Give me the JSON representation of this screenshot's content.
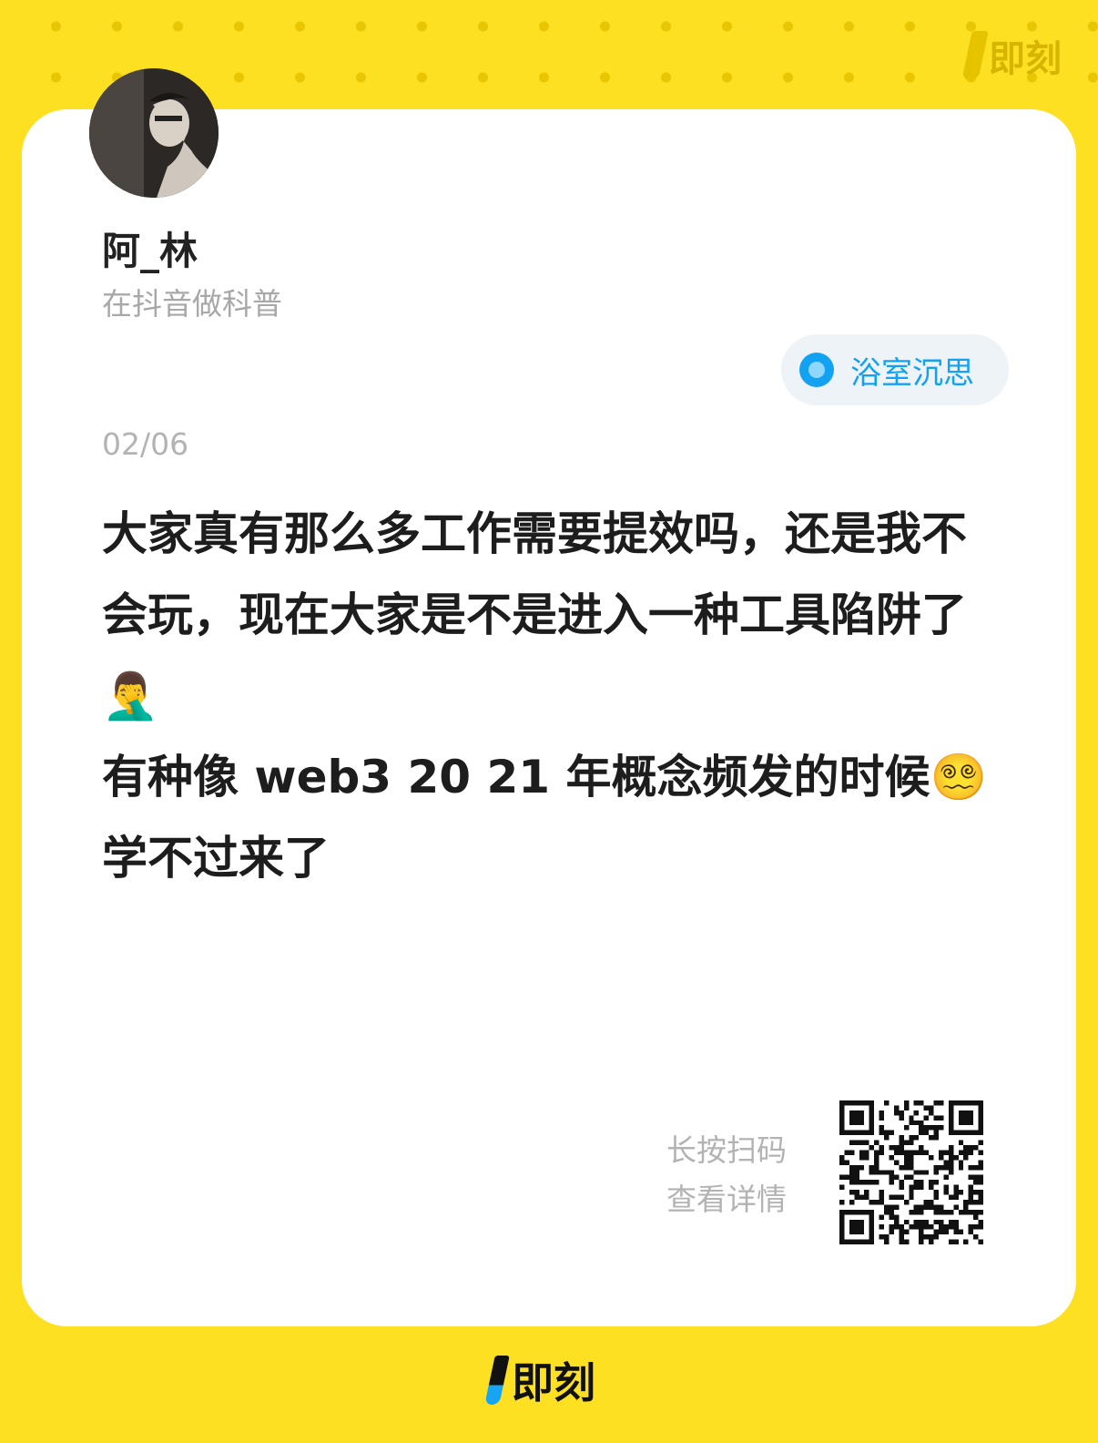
{
  "brand": {
    "name": "即刻"
  },
  "author": {
    "name": "阿_林",
    "bio": "在抖音做科普"
  },
  "topic": {
    "label": "浴室沉思"
  },
  "post": {
    "date": "02/06",
    "text": "大家真有那么多工作需要提效吗，还是我不会玩，现在大家是不是进入一种工具陷阱了🤦‍♂️\n有种像 web3 20 21 年概念频发的时候😵‍💫学不过来了"
  },
  "scan_hint": {
    "line1": "长按扫码",
    "line2": "查看详情"
  },
  "colors": {
    "background": "#FDE022",
    "topic_accent": "#13A2F2",
    "card": "#FFFFFF"
  }
}
